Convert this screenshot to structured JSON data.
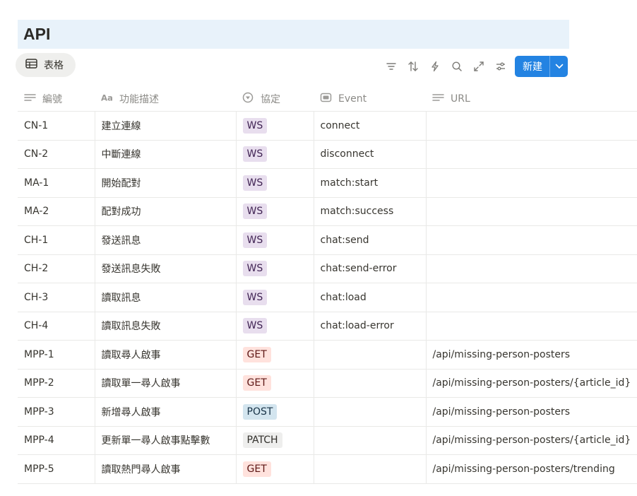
{
  "page": {
    "title": "API"
  },
  "view": {
    "tab_label": "表格"
  },
  "toolbar": {
    "icons": [
      "filter-icon",
      "sort-icon",
      "automation-icon",
      "search-icon",
      "expand-icon",
      "settings-icon"
    ],
    "new_label": "新建"
  },
  "table": {
    "columns": [
      {
        "label": "編號",
        "icon": "text-icon"
      },
      {
        "label": "功能描述",
        "icon": "title-icon"
      },
      {
        "label": "協定",
        "icon": "select-icon"
      },
      {
        "label": "Event",
        "icon": "formula-icon"
      },
      {
        "label": "URL",
        "icon": "text-icon"
      }
    ],
    "rows": [
      {
        "id": "CN-1",
        "desc": "建立連線",
        "protocol": "WS",
        "event": "connect",
        "url": ""
      },
      {
        "id": "CN-2",
        "desc": "中斷連線",
        "protocol": "WS",
        "event": "disconnect",
        "url": ""
      },
      {
        "id": "MA-1",
        "desc": "開始配對",
        "protocol": "WS",
        "event": "match:start",
        "url": ""
      },
      {
        "id": "MA-2",
        "desc": "配對成功",
        "protocol": "WS",
        "event": "match:success",
        "url": ""
      },
      {
        "id": "CH-1",
        "desc": "發送訊息",
        "protocol": "WS",
        "event": "chat:send",
        "url": ""
      },
      {
        "id": "CH-2",
        "desc": "發送訊息失敗",
        "protocol": "WS",
        "event": "chat:send-error",
        "url": ""
      },
      {
        "id": "CH-3",
        "desc": "讀取訊息",
        "protocol": "WS",
        "event": "chat:load",
        "url": ""
      },
      {
        "id": "CH-4",
        "desc": "讀取訊息失敗",
        "protocol": "WS",
        "event": "chat:load-error",
        "url": ""
      },
      {
        "id": "MPP-1",
        "desc": "讀取尋人啟事",
        "protocol": "GET",
        "event": "",
        "url": "/api/missing-person-posters"
      },
      {
        "id": "MPP-2",
        "desc": "讀取單一尋人啟事",
        "protocol": "GET",
        "event": "",
        "url": "/api/missing-person-posters/{article_id}"
      },
      {
        "id": "MPP-3",
        "desc": "新增尋人啟事",
        "protocol": "POST",
        "event": "",
        "url": "/api/missing-person-posters"
      },
      {
        "id": "MPP-4",
        "desc": "更新單一尋人啟事點擊數",
        "protocol": "PATCH",
        "event": "",
        "url": "/api/missing-person-posters/{article_id}"
      },
      {
        "id": "MPP-5",
        "desc": "讀取熱門尋人啟事",
        "protocol": "GET",
        "event": "",
        "url": "/api/missing-person-posters/trending"
      }
    ]
  },
  "colors": {
    "title_bg": "#e8f2fa",
    "accent": "#2383e2",
    "tag_ws": "#e8deee",
    "tag_get": "#ffe2dd",
    "tag_post": "#d3e5ef",
    "tag_patch": "#eeeeed"
  }
}
